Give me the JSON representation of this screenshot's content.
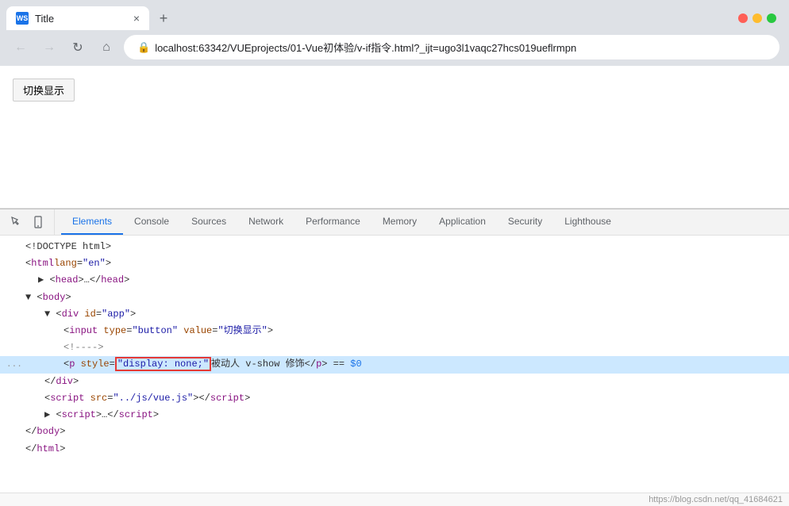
{
  "browser": {
    "tab": {
      "favicon_label": "WS",
      "title": "Title",
      "close_label": "×",
      "new_tab_label": "+"
    },
    "nav": {
      "back_label": "←",
      "forward_label": "→",
      "reload_label": "↻",
      "home_label": "⌂",
      "url": "localhost:63342/VUEprojects/01-Vue初体验/v-if指令.html?_ijt=ugo3l1vaqc27hcs019ueflrmpn"
    }
  },
  "page": {
    "button_label": "切换显示"
  },
  "devtools": {
    "tabs": [
      {
        "id": "elements",
        "label": "Elements",
        "active": true
      },
      {
        "id": "console",
        "label": "Console",
        "active": false
      },
      {
        "id": "sources",
        "label": "Sources",
        "active": false
      },
      {
        "id": "network",
        "label": "Network",
        "active": false
      },
      {
        "id": "performance",
        "label": "Performance",
        "active": false
      },
      {
        "id": "memory",
        "label": "Memory",
        "active": false
      },
      {
        "id": "application",
        "label": "Application",
        "active": false
      },
      {
        "id": "security",
        "label": "Security",
        "active": false
      },
      {
        "id": "lighthouse",
        "label": "Lighthouse",
        "active": false
      }
    ],
    "code_lines": [
      {
        "id": "doctype",
        "indent": 0,
        "html": "&lt;!DOCTYPE html&gt;",
        "highlighted": false,
        "dots": false
      },
      {
        "id": "html-open",
        "indent": 0,
        "html": "&lt;html lang=<span class='attr-value'>\"en\"</span>&gt;",
        "highlighted": false,
        "dots": false
      },
      {
        "id": "head",
        "indent": 1,
        "html": "&#9658;&lt;head&gt;…&lt;/head&gt;",
        "highlighted": false,
        "dots": false
      },
      {
        "id": "body-open",
        "indent": 0,
        "html": "&#9660;&lt;body&gt;",
        "highlighted": false,
        "dots": false
      },
      {
        "id": "div-open",
        "indent": 2,
        "html": "&#9660;&lt;div id=<span class='attr-value'>\"app\"</span>&gt;",
        "highlighted": false,
        "dots": false
      },
      {
        "id": "input",
        "indent": 4,
        "html": "&lt;input type=<span class='attr-value'>\"button\"</span> value=<span class='attr-value'>\"切换显示\"</span>&gt;",
        "highlighted": false,
        "dots": false
      },
      {
        "id": "comment",
        "indent": 4,
        "html": "<span class='comment'>&lt;!----&gt;</span>",
        "highlighted": false,
        "dots": false
      },
      {
        "id": "p-line",
        "indent": 4,
        "html": "&lt;p style=<span class='highlight-box'><span class='attr-value'>\"display: none;\"</span></span>被动人 v-show 修饰&lt;/p&gt; == <span class='vue-blue'>$0</span>",
        "highlighted": true,
        "dots": true
      },
      {
        "id": "div-close",
        "indent": 2,
        "html": "&lt;/div&gt;",
        "highlighted": false,
        "dots": false
      },
      {
        "id": "script1",
        "indent": 2,
        "html": "&lt;script src=<span class='attr-value'>\"../js/vue.js\"</span>&gt;&lt;/script&gt;",
        "highlighted": false,
        "dots": false
      },
      {
        "id": "script2",
        "indent": 2,
        "html": "&#9658;&lt;script&gt;…&lt;/script&gt;",
        "highlighted": false,
        "dots": false
      },
      {
        "id": "body-close",
        "indent": 0,
        "html": "&lt;/body&gt;",
        "highlighted": false,
        "dots": false
      },
      {
        "id": "html-close",
        "indent": 0,
        "html": "&lt;/html&gt;",
        "highlighted": false,
        "dots": false
      }
    ]
  },
  "footer": {
    "watermark": "https://blog.csdn.net/qq_41684621"
  }
}
